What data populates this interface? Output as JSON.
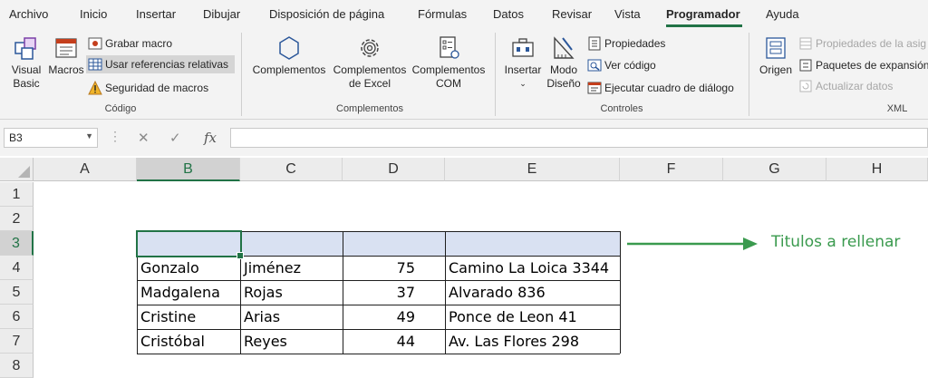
{
  "tabs": [
    "Archivo",
    "Inicio",
    "Insertar",
    "Dibujar",
    "Disposición de página",
    "Fórmulas",
    "Datos",
    "Revisar",
    "Vista",
    "Programador",
    "Ayuda"
  ],
  "active_tab": "Programador",
  "ribbon": {
    "codigo": {
      "visual_basic": "Visual\nBasic",
      "macros": "Macros",
      "grabar_macro": "Grabar macro",
      "usar_referencias": "Usar referencias relativas",
      "seguridad": "Seguridad de macros",
      "label": "Código"
    },
    "complementos": {
      "complementos": "Complementos",
      "complementos_excel": "Complementos\nde Excel",
      "complementos_com": "Complementos\nCOM",
      "label": "Complementos"
    },
    "controles": {
      "insertar": "Insertar",
      "modo_diseno": "Modo\nDiseño",
      "propiedades": "Propiedades",
      "ver_codigo": "Ver código",
      "ejecutar_cuadro": "Ejecutar cuadro de diálogo",
      "label": "Controles"
    },
    "xml": {
      "origen": "Origen",
      "propiedades_asig": "Propiedades de la asig",
      "paquetes": "Paquetes de expansión",
      "actualizar": "Actualizar datos",
      "label": "XML"
    }
  },
  "formula_bar": {
    "name_box": "B3",
    "cancel_symbol": "✕",
    "enter_symbol": "✓",
    "fx_symbol": "fx",
    "formula": ""
  },
  "columns": [
    "A",
    "B",
    "C",
    "D",
    "E",
    "F",
    "G",
    "H"
  ],
  "rows": [
    "1",
    "2",
    "3",
    "4",
    "5",
    "6",
    "7",
    "8"
  ],
  "selected_cell": "B3",
  "table_rows": [
    {
      "b": "Gonzalo",
      "c": "Jiménez",
      "d": "75",
      "e": "Camino La Loica 3344"
    },
    {
      "b": "Madgalena",
      "c": "Rojas",
      "d": "37",
      "e": "Alvarado 836"
    },
    {
      "b": "Cristine",
      "c": "Arias",
      "d": "49",
      "e": "Ponce de Leon 41"
    },
    {
      "b": "Cristóbal",
      "c": "Reyes",
      "d": "44",
      "e": "Av. Las Flores 298"
    }
  ],
  "annotation": "Titulos a rellenar",
  "colors": {
    "accent_green": "#217346",
    "header_fill": "#d9e1f2",
    "annotation_green": "#3a9a4e"
  }
}
